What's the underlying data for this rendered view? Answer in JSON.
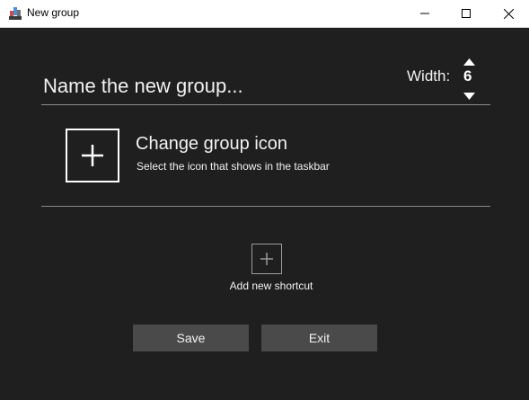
{
  "window": {
    "title": "New group",
    "app_icon": "group-app-icon",
    "controls": [
      "minimize-icon",
      "maximize-icon",
      "close-icon"
    ]
  },
  "name_field": {
    "value": "",
    "placeholder": "Name the new group..."
  },
  "width": {
    "label": "Width:",
    "value": "6",
    "up_icon": "triangle-up-icon",
    "down_icon": "triangle-down-icon"
  },
  "group_icon": {
    "icon": "plus-icon",
    "title": "Change group icon",
    "subtitle": "Select the icon that shows in the taskbar"
  },
  "shortcut": {
    "icon": "plus-icon",
    "label": "Add new shortcut"
  },
  "buttons": {
    "save": "Save",
    "exit": "Exit"
  },
  "colors": {
    "background": "#1f1f1f",
    "button": "#4a4a4a",
    "text": "#f2f2f2",
    "divider": "#8a8a8a"
  }
}
